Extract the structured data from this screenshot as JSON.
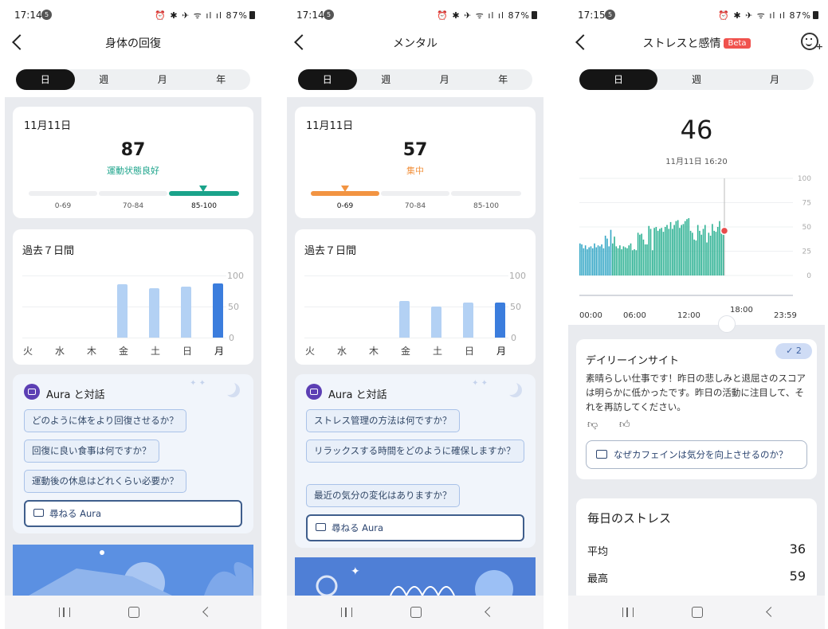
{
  "status": [
    {
      "time": "17:14",
      "notif": "5",
      "battery": "87%"
    },
    {
      "time": "17:14",
      "notif": "5",
      "battery": "87%"
    },
    {
      "time": "17:15",
      "notif": "5",
      "battery": "87%"
    }
  ],
  "recovery": {
    "title": "身体の回復",
    "tabs": [
      "日",
      "週",
      "月",
      "年"
    ],
    "date": "11月11日",
    "score": "87",
    "score_label": "運動状態良好",
    "score_color": "#1aa38a",
    "ranges": [
      "0-69",
      "70-84",
      "85-100"
    ],
    "active_range_index": 2,
    "week_title": "過去７日間",
    "y_ticks": [
      "100",
      "50",
      "0"
    ],
    "days": [
      "火",
      "水",
      "木",
      "金",
      "土",
      "日",
      "月"
    ],
    "values": [
      0,
      0,
      0,
      86,
      80,
      82,
      87
    ],
    "aura": {
      "title": "Aura と対話",
      "questions": [
        "どのように体をより回復させるか？",
        "回復に良い食事は何ですか？",
        "運動後の休息はどれくらい必要か？"
      ],
      "ask": "尋ねる Aura"
    }
  },
  "mental": {
    "title": "メンタル",
    "tabs": [
      "日",
      "週",
      "月",
      "年"
    ],
    "date": "11月11日",
    "score": "57",
    "score_label": "集中",
    "score_color": "#f29442",
    "ranges": [
      "0-69",
      "70-84",
      "85-100"
    ],
    "active_range_index": 0,
    "week_title": "過去７日間",
    "y_ticks": [
      "100",
      "50",
      "0"
    ],
    "days": [
      "火",
      "水",
      "木",
      "金",
      "土",
      "日",
      "月"
    ],
    "values": [
      0,
      0,
      0,
      59,
      50,
      56,
      57
    ],
    "aura": {
      "title": "Aura と対話",
      "questions": [
        "ストレス管理の方法は何ですか？",
        "リラックスする時間をどのように確保しますか？",
        "最近の気分の変化はありますか？"
      ],
      "ask": "尋ねる Aura"
    }
  },
  "stress": {
    "title": "ストレスと感情",
    "beta": "Beta",
    "tabs": [
      "日",
      "週",
      "月"
    ],
    "score": "46",
    "datetime": "11月11日 16:20",
    "y_ticks": [
      "100",
      "75",
      "50",
      "25",
      "0"
    ],
    "x_ticks": [
      "00:00",
      "06:00",
      "12:00",
      "18:00",
      "23:59"
    ],
    "insight": {
      "title": "デイリーインサイト",
      "badge": "2",
      "text": "素晴らしい仕事です！昨日の悲しみと退屈さのスコアは明らかに低かったです。昨日の活動に注目して、それを再訪してください。",
      "question": "なぜカフェインは気分を向上させるのか？"
    },
    "daily": {
      "title": "毎日のストレス",
      "avg_label": "平均",
      "avg": "36",
      "max_label": "最高",
      "max": "59"
    },
    "bar_color": "#2fb294"
  },
  "chart_data": [
    {
      "type": "bar",
      "title": "過去７日間",
      "categories": [
        "火",
        "水",
        "木",
        "金",
        "土",
        "日",
        "月"
      ],
      "values": [
        0,
        0,
        0,
        86,
        80,
        82,
        87
      ],
      "ylim": [
        0,
        100
      ]
    },
    {
      "type": "bar",
      "title": "過去７日間",
      "categories": [
        "火",
        "水",
        "木",
        "金",
        "土",
        "日",
        "月"
      ],
      "values": [
        0,
        0,
        0,
        59,
        50,
        56,
        57
      ],
      "ylim": [
        0,
        100
      ]
    },
    {
      "type": "bar",
      "title": "",
      "x_range": [
        "00:00",
        "23:59"
      ],
      "ylim": [
        0,
        100
      ],
      "values": [
        33,
        32,
        28,
        31,
        27,
        29,
        30,
        28,
        33,
        29,
        31,
        30,
        32,
        28,
        41,
        38,
        30,
        47,
        33,
        40,
        30,
        28,
        31,
        27,
        30,
        29,
        28,
        31,
        33,
        26,
        27,
        26,
        44,
        42,
        43,
        37,
        32,
        32,
        51,
        48,
        26,
        49,
        50,
        46,
        48,
        49,
        45,
        50,
        52,
        48,
        55,
        48,
        52,
        56,
        57,
        49,
        52,
        53,
        56,
        58,
        59,
        46,
        44,
        37,
        36,
        52,
        46,
        42,
        48,
        52,
        34,
        44,
        41,
        53,
        46,
        45,
        50,
        56,
        45,
        46
      ]
    }
  ]
}
